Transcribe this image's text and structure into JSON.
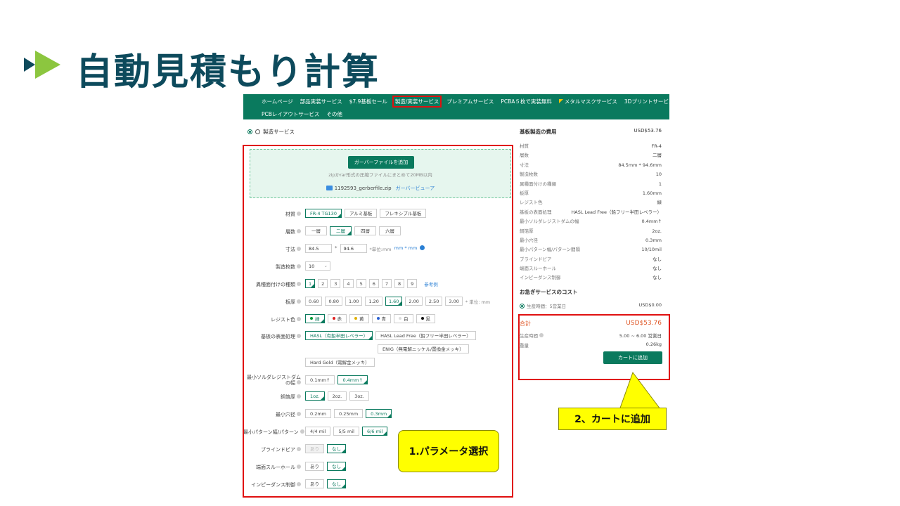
{
  "slide": {
    "title": "自動見積もり計算",
    "accent_dark": "#0d4a5c",
    "accent_green": "#8cc63f"
  },
  "nav": {
    "row1": [
      "ホームページ",
      "部品実装サービス",
      "$7.9基板セール",
      "製造/実装サービス",
      "プレミアムサービス",
      "PCBA５枚で実装無料",
      "メタルマスクサービス",
      "3Dプリントサービス"
    ],
    "row2": [
      "PCBレイアウトサービス",
      "その他"
    ],
    "active_index": 3,
    "color": "#0a7a5e"
  },
  "left": {
    "service_label": "製造サービス",
    "upload_button": "ガーバーファイルを追加",
    "upload_hint": "zipかrar形式の圧縮ファイルにまとめて20MB以内",
    "file_name": "1192593_gerberfile.zip",
    "viewer_link": "ガーバービューア",
    "params": {
      "material": {
        "label": "材質",
        "options": [
          "FR-4 TG130",
          "アルミ基板",
          "フレキシブル基板"
        ]
      },
      "layers": {
        "label": "層数",
        "options": [
          "一層",
          "二層",
          "四層",
          "六層"
        ]
      },
      "size": {
        "label": "寸法",
        "width": "84.5",
        "height": "94.6",
        "sep": "*",
        "unit_hint": "*単位:mm",
        "unit_link": "mm * mm"
      },
      "quantity": {
        "label": "製造枚数",
        "value": "10"
      },
      "designs": {
        "label": "異種面付けの種類",
        "options": [
          "1",
          "2",
          "3",
          "4",
          "5",
          "6",
          "7",
          "8",
          "9"
        ],
        "ref": "参考例"
      },
      "thickness": {
        "label": "板厚",
        "options": [
          "0.60",
          "0.80",
          "1.00",
          "1.20",
          "1.60",
          "2.00",
          "2.50",
          "3.00"
        ],
        "unit": "* 単位: mm"
      },
      "resist": {
        "label": "レジスト色",
        "options": [
          "緑",
          "赤",
          "黄",
          "青",
          "白",
          "黒"
        ],
        "colors": [
          "#0a9a3a",
          "#e02020",
          "#e0b000",
          "#2a60d0",
          "#dddddd",
          "#111111"
        ]
      },
      "finish": {
        "label": "基板の表面処理",
        "options": [
          "HASL（有鉛半田レベラー）",
          "HASL Lead Free（鉛フリー半田レベラー）",
          "ENIG（無電解ニッケル/置換金メッキ）",
          "Hard Gold（電解金メッキ）"
        ]
      },
      "min_resist": {
        "label": "最小ソルダレジストダムの幅",
        "options": [
          "0.1mm↑",
          "0.4mm↑"
        ]
      },
      "copper": {
        "label": "銅箔厚",
        "options": [
          "1oz.",
          "2oz.",
          "3oz."
        ]
      },
      "min_hole": {
        "label": "最小穴径",
        "options": [
          "0.2mm",
          "0.25mm",
          "0.3mm"
        ]
      },
      "min_trace": {
        "label": "最小パターン幅/パターン",
        "options": [
          "4/4 mil",
          "5/5 mil",
          "6/6 mil"
        ]
      },
      "blind_via": {
        "label": "ブラインドビア",
        "options": [
          "あり",
          "なし"
        ]
      },
      "castellated": {
        "label": "端面スルーホール",
        "options": [
          "あり",
          "なし"
        ]
      },
      "impedance": {
        "label": "インピーダンス制御",
        "options": [
          "あり",
          "なし"
        ]
      }
    }
  },
  "right": {
    "header_label": "基板製造の費用",
    "header_amount": "USD$53.76",
    "rows": [
      {
        "k": "材質",
        "v": "FR-4"
      },
      {
        "k": "層数",
        "v": "二層"
      },
      {
        "k": "寸法",
        "v": "84.5mm * 94.6mm"
      },
      {
        "k": "製造枚数",
        "v": "10"
      },
      {
        "k": "異種面付けの種類",
        "v": "1"
      },
      {
        "k": "板厚",
        "v": "1.60mm"
      },
      {
        "k": "レジスト色",
        "v": "緑"
      },
      {
        "k": "基板の表面処理",
        "v": "HASL Lead Free（鉛フリー半田レベラー）"
      },
      {
        "k": "最小ソルダレジストダムの幅",
        "v": "0.4mm↑"
      },
      {
        "k": "銅箔厚",
        "v": "2oz."
      },
      {
        "k": "最小穴径",
        "v": "0.3mm"
      },
      {
        "k": "最小パターン幅/パターン間隔",
        "v": "10/10mil"
      },
      {
        "k": "ブラインドビア",
        "v": "なし"
      },
      {
        "k": "端面スルーホール",
        "v": "なし"
      },
      {
        "k": "インピーダンス制御",
        "v": "なし"
      }
    ],
    "urgent_title": "お急ぎサービスのコスト",
    "urgent_label": "生産時間：5営業日",
    "urgent_amount": "USD$0.00",
    "total_label": "合計",
    "total_amount": "USD$53.76",
    "production_label": "生産時間",
    "production_value": "5.00 ~ 6.00 営業日",
    "weight_label": "重量",
    "weight_value": "0.26kg",
    "cart_button": "カートに追加"
  },
  "callouts": {
    "params": "1.パラメータ選択",
    "cart": "2、カートに追加"
  }
}
